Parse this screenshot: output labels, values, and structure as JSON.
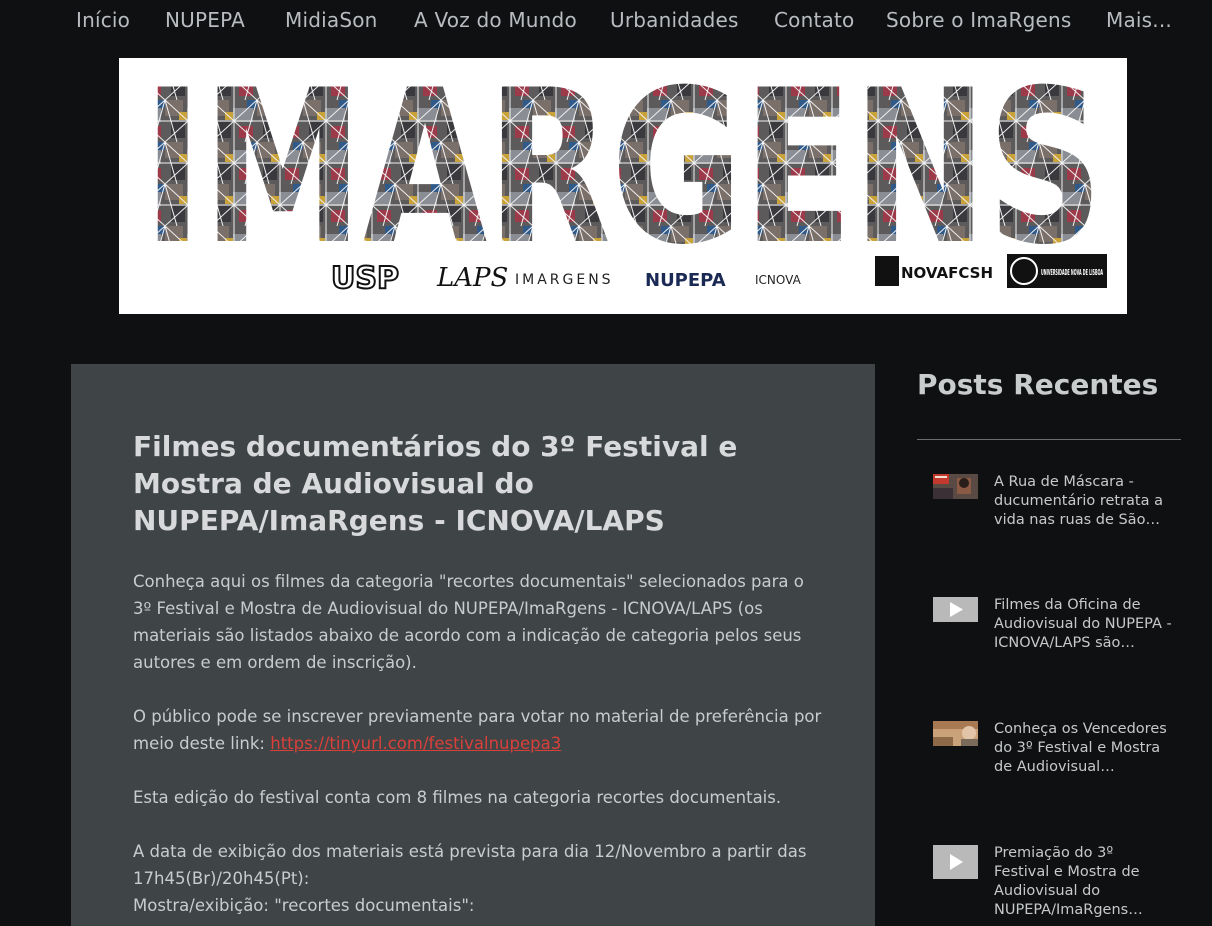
{
  "nav": {
    "items": [
      "Início",
      "NUPEPA",
      "MidiaSon",
      "A Voz do Mundo",
      "Urbanidades",
      "Contato",
      "Sobre o ImaRgens",
      "Mais..."
    ]
  },
  "banner": {
    "wordmark": "IMARGENS",
    "logos": [
      "USP",
      "LAPS",
      "IMARGENS",
      "NUPEPA",
      "ICNOVA",
      "NOVAFCSH",
      "UNIVERSIDADE NOVA DE LISBOA"
    ]
  },
  "post": {
    "title": "Filmes documentários do 3º Festival e Mostra de Audiovisual do NUPEPA/ImaRgens - ICNOVA/LAPS",
    "p1": "Conheça aqui os filmes da categoria \"recortes documentais\"  selecionados para o 3º Festival e Mostra de Audiovisual do NUPEPA/ImaRgens - ICNOVA/LAPS (os materiais são listados abaixo de acordo com a indicação de categoria pelos seus autores e em ordem de inscrição).",
    "p2_prefix": "O público pode se inscrever previamente para votar no material de preferência por meio deste link: ",
    "p2_link": "https://tinyurl.com/festivalnupepa3",
    "p3": "Esta edição do festival conta com 8 filmes na categoria recortes documentais.",
    "p4_line1": "A data de exibição dos materiais está prevista para dia 12/Novembro a partir das 17h45(Br)/20h45(Pt):",
    "p4_line2": "Mostra/exibição: \"recortes documentais\":"
  },
  "sidebar": {
    "title": "Posts Recentes",
    "posts": [
      {
        "title": "A Rua de Máscara - ducumentário retrata a vida nas ruas de São…",
        "thumb": "photo-thumbnail"
      },
      {
        "title": "Filmes da Oficina de Audiovisual do NUPEPA - ICNOVA/LAPS são…",
        "thumb": "video-play-icon"
      },
      {
        "title": "Conheça os Vencedores do 3º Festival e Mostra de Audiovisual…",
        "thumb": "photo-thumbnail"
      },
      {
        "title": "Premiação do 3º Festival e Mostra de Audiovisual do NUPEPA/ImaRgens…",
        "thumb": "video-play-icon"
      }
    ]
  },
  "colors": {
    "page_bg": "#0f1012",
    "post_bg": "#3f4446",
    "link": "#d9403a",
    "nav_text": "#b8bcc0"
  }
}
